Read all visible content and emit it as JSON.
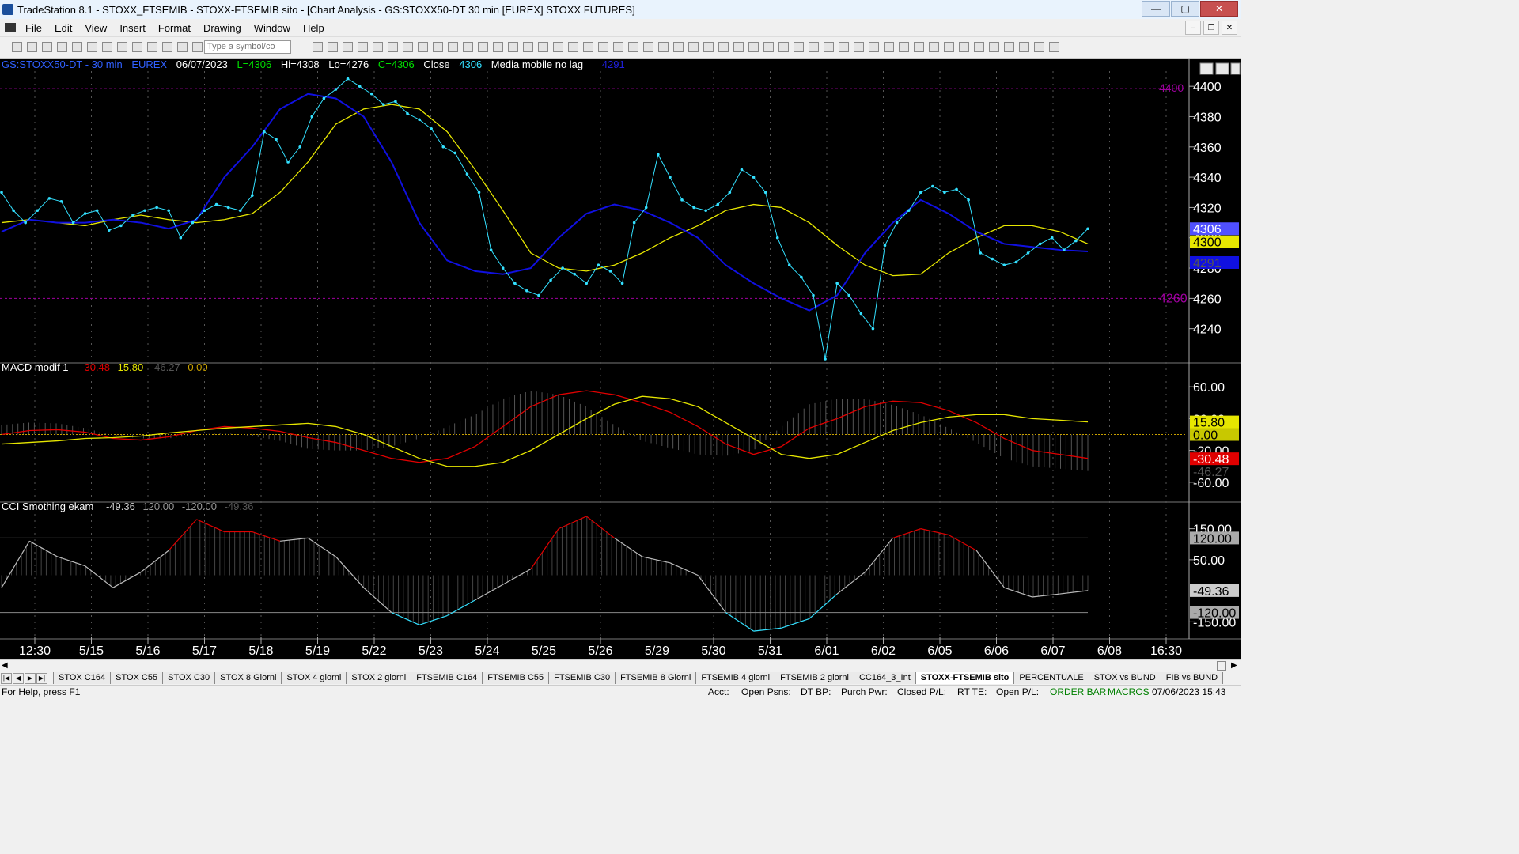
{
  "window": {
    "title": "TradeStation 8.1 - STOXX_FTSEMIB - STOXX-FTSEMIB sito - [Chart Analysis - GS:STOXX50-DT  30 min  [EUREX] STOXX FUTURES]"
  },
  "menu": [
    "File",
    "Edit",
    "View",
    "Insert",
    "Format",
    "Drawing",
    "Window",
    "Help"
  ],
  "toolbar": {
    "symbol_placeholder": "Type a symbol/co"
  },
  "status_line": {
    "symbol": "GS:STOXX50-DT - 30 min",
    "exchange": "EUREX",
    "date": "06/07/2023",
    "low_label": "L=4306",
    "high_label": "Hi=4308",
    "lo_label": "Lo=4276",
    "close_label": "C=4306",
    "close_word": "Close",
    "close_value": "4306",
    "indicator": "Media mobile no lag",
    "indicator_value": "4291"
  },
  "macd_header": {
    "name": "MACD modif 1",
    "v1": "-30.48",
    "v2": "15.80",
    "v3": "-46.27",
    "v4": "0.00"
  },
  "cci_header": {
    "name": "CCI Smothing ekam",
    "v1": "-49.36",
    "v2": "120.00",
    "v3": "-120.00",
    "v4": "-49.36"
  },
  "price_axis": [
    "4400",
    "4380",
    "4360",
    "4340",
    "4320",
    "4300",
    "4280",
    "4260",
    "4240"
  ],
  "macd_axis": [
    "60.00",
    "20.00",
    "-20.00",
    "-60.00"
  ],
  "cci_axis": [
    "150.00",
    "50.00",
    "-150.00"
  ],
  "price_markers": {
    "top_ref": "4400",
    "level": "4260",
    "close": "4306",
    "ma_yellow": "4300",
    "ma_blue": "4291"
  },
  "macd_markers": [
    "15.80",
    "0.00",
    "-30.48",
    "-46.27"
  ],
  "cci_markers": [
    "120.00",
    "-49.36",
    "-120.00"
  ],
  "time_axis": [
    "12:30",
    "5/15",
    "5/16",
    "5/17",
    "5/18",
    "5/19",
    "5/22",
    "5/23",
    "5/24",
    "5/25",
    "5/26",
    "5/29",
    "5/30",
    "5/31",
    "6/01",
    "6/02",
    "6/05",
    "6/06",
    "6/07",
    "6/08",
    "16:30"
  ],
  "tabs": [
    "STOX C164",
    "STOX C55",
    "STOX  C30",
    "STOX  8 Giorni",
    "STOX 4 giorni",
    "STOX  2 giorni",
    "FTSEMIB C164",
    "FTSEMIB C55",
    "FTSEMIB C30",
    "FTSEMIB  8 Giorni",
    "FTSEMIB  4 giorni",
    "FTSEMIB  2 giorni",
    "CC164_3_Int",
    "STOXX-FTSEMIB sito",
    "PERCENTUALE",
    "STOX vs BUND",
    "FIB vs BUND"
  ],
  "active_tab": "STOXX-FTSEMIB sito",
  "statusbar": {
    "help": "For Help, press F1",
    "acct": "Acct:",
    "open_psns": "Open Psns:",
    "dt_bp": "DT BP:",
    "purch_pwr": "Purch Pwr:",
    "closed_pl": "Closed P/L:",
    "rt_te": "RT TE:",
    "open_pl": "Open P/L:",
    "order_bar": "ORDER BAR",
    "macros": "MACROS",
    "datetime": "07/06/2023 15:43"
  },
  "colors": {
    "cyan": "#33e0ff",
    "blue": "#1010e0",
    "yellow": "#e6e600",
    "red": "#e00000",
    "grid": "#555555",
    "purple": "#a000a0"
  },
  "chart_data": {
    "type": "line",
    "price_series_close": [
      4330,
      4318,
      4310,
      4318,
      4326,
      4324,
      4310,
      4316,
      4318,
      4305,
      4308,
      4315,
      4318,
      4320,
      4318,
      4300,
      4310,
      4318,
      4322,
      4320,
      4318,
      4328,
      4370,
      4365,
      4350,
      4360,
      4380,
      4392,
      4398,
      4405,
      4400,
      4395,
      4388,
      4390,
      4382,
      4378,
      4372,
      4360,
      4356,
      4342,
      4330,
      4292,
      4280,
      4270,
      4265,
      4262,
      4272,
      4280,
      4276,
      4270,
      4282,
      4278,
      4270,
      4310,
      4320,
      4355,
      4340,
      4325,
      4320,
      4318,
      4322,
      4330,
      4345,
      4340,
      4330,
      4300,
      4282,
      4274,
      4262,
      4220,
      4270,
      4262,
      4250,
      4240,
      4295,
      4310,
      4318,
      4330,
      4334,
      4330,
      4332,
      4325,
      4290,
      4286,
      4282,
      4284,
      4290,
      4296,
      4300,
      4292,
      4298,
      4306
    ],
    "ma_yellow": [
      4310,
      4312,
      4310,
      4308,
      4312,
      4315,
      4312,
      4310,
      4312,
      4316,
      4330,
      4350,
      4375,
      4385,
      4388,
      4385,
      4370,
      4345,
      4318,
      4290,
      4280,
      4278,
      4282,
      4290,
      4300,
      4308,
      4318,
      4322,
      4320,
      4310,
      4295,
      4282,
      4275,
      4276,
      4290,
      4300,
      4308,
      4308,
      4304,
      4296
    ],
    "ma_blue": [
      4304,
      4312,
      4310,
      4310,
      4312,
      4310,
      4306,
      4312,
      4340,
      4360,
      4385,
      4395,
      4392,
      4380,
      4350,
      4310,
      4285,
      4278,
      4276,
      4280,
      4300,
      4316,
      4322,
      4318,
      4310,
      4300,
      4282,
      4270,
      4260,
      4252,
      4262,
      4290,
      4310,
      4325,
      4316,
      4304,
      4296,
      4294,
      4292,
      4291
    ],
    "macd_red": [
      0,
      5,
      6,
      3,
      -5,
      -7,
      -3,
      5,
      10,
      8,
      4,
      -4,
      -10,
      -20,
      -30,
      -35,
      -30,
      -15,
      10,
      35,
      50,
      55,
      50,
      40,
      28,
      10,
      -12,
      -25,
      -15,
      8,
      20,
      35,
      42,
      40,
      30,
      15,
      -5,
      -20,
      -25,
      -30
    ],
    "macd_yellow": [
      -12,
      -10,
      -8,
      -5,
      -4,
      -2,
      2,
      5,
      8,
      10,
      12,
      14,
      10,
      0,
      -15,
      -30,
      -40,
      -40,
      -35,
      -20,
      0,
      20,
      38,
      48,
      45,
      35,
      15,
      -5,
      -25,
      -30,
      -25,
      -10,
      5,
      15,
      22,
      25,
      25,
      20,
      18,
      15.8
    ],
    "cci_line": [
      -40,
      110,
      60,
      30,
      -40,
      10,
      80,
      180,
      140,
      140,
      110,
      120,
      60,
      -40,
      -120,
      -160,
      -130,
      -80,
      -30,
      20,
      150,
      190,
      120,
      60,
      40,
      0,
      -120,
      -180,
      -170,
      -140,
      -60,
      10,
      120,
      150,
      130,
      80,
      -40,
      -70,
      -60,
      -49.36
    ],
    "ylim_price": [
      4220,
      4410
    ],
    "ylim_macd": [
      -80,
      80
    ],
    "ylim_cci": [
      -200,
      200
    ]
  }
}
